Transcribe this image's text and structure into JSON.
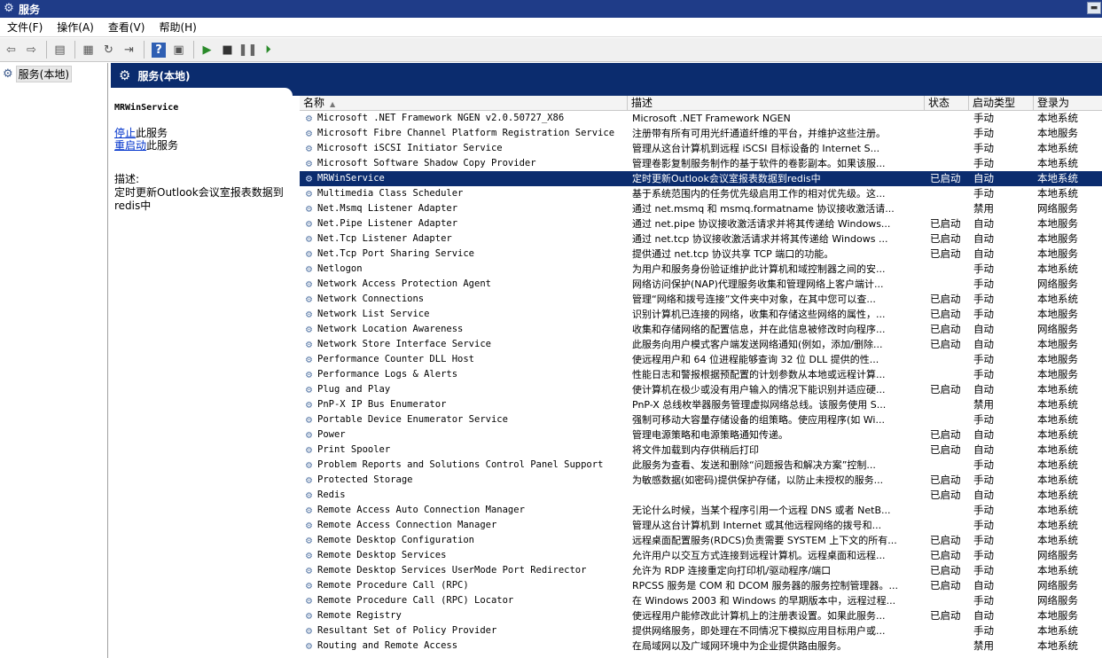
{
  "window": {
    "title": "服务"
  },
  "menu": [
    {
      "label": "文件(F)"
    },
    {
      "label": "操作(A)"
    },
    {
      "label": "查看(V)"
    },
    {
      "label": "帮助(H)"
    }
  ],
  "tree": {
    "item_label": "服务(本地)"
  },
  "main": {
    "title": "服务(本地)"
  },
  "detail": {
    "service_name": "MRWinService",
    "stop_link": "停止",
    "stop_suffix": "此服务",
    "restart_link": "重启动",
    "restart_suffix": "此服务",
    "desc_label": "描述:",
    "description": "定时更新Outlook会议室报表数据到redis中"
  },
  "table": {
    "columns": {
      "name": "名称",
      "desc": "描述",
      "status": "状态",
      "startup": "启动类型",
      "logon": "登录为"
    },
    "selected_index": 4,
    "rows": [
      {
        "name": "Microsoft .NET Framework NGEN v2.0.50727_X86",
        "desc": "Microsoft .NET Framework NGEN",
        "status": "",
        "startup": "手动",
        "logon": "本地系统"
      },
      {
        "name": "Microsoft Fibre Channel Platform Registration Service",
        "desc": "注册带有所有可用光纤通道纤维的平台，并维护这些注册。",
        "status": "",
        "startup": "手动",
        "logon": "本地服务"
      },
      {
        "name": "Microsoft iSCSI Initiator Service",
        "desc": "管理从这台计算机到远程 iSCSI 目标设备的 Internet S...",
        "status": "",
        "startup": "手动",
        "logon": "本地系统"
      },
      {
        "name": "Microsoft Software Shadow Copy Provider",
        "desc": "管理卷影复制服务制作的基于软件的卷影副本。如果该服...",
        "status": "",
        "startup": "手动",
        "logon": "本地系统"
      },
      {
        "name": "MRWinService",
        "desc": "定时更新Outlook会议室报表数据到redis中",
        "status": "已启动",
        "startup": "自动",
        "logon": "本地系统"
      },
      {
        "name": "Multimedia Class Scheduler",
        "desc": "基于系统范围内的任务优先级启用工作的相对优先级。这...",
        "status": "",
        "startup": "手动",
        "logon": "本地系统"
      },
      {
        "name": "Net.Msmq Listener Adapter",
        "desc": "通过 net.msmq 和 msmq.formatname 协议接收激活请...",
        "status": "",
        "startup": "禁用",
        "logon": "网络服务"
      },
      {
        "name": "Net.Pipe Listener Adapter",
        "desc": "通过 net.pipe 协议接收激活请求并将其传递给 Windows...",
        "status": "已启动",
        "startup": "自动",
        "logon": "本地服务"
      },
      {
        "name": "Net.Tcp Listener Adapter",
        "desc": "通过 net.tcp 协议接收激活请求并将其传递给 Windows ...",
        "status": "已启动",
        "startup": "自动",
        "logon": "本地服务"
      },
      {
        "name": "Net.Tcp Port Sharing Service",
        "desc": "提供通过 net.tcp 协议共享 TCP 端口的功能。",
        "status": "已启动",
        "startup": "自动",
        "logon": "本地服务"
      },
      {
        "name": "Netlogon",
        "desc": "为用户和服务身份验证维护此计算机和域控制器之间的安...",
        "status": "",
        "startup": "手动",
        "logon": "本地系统"
      },
      {
        "name": "Network Access Protection Agent",
        "desc": "网络访问保护(NAP)代理服务收集和管理网络上客户端计...",
        "status": "",
        "startup": "手动",
        "logon": "网络服务"
      },
      {
        "name": "Network Connections",
        "desc": "管理“网络和拨号连接”文件夹中对象，在其中您可以查...",
        "status": "已启动",
        "startup": "手动",
        "logon": "本地系统"
      },
      {
        "name": "Network List Service",
        "desc": "识别计算机已连接的网络，收集和存储这些网络的属性，...",
        "status": "已启动",
        "startup": "手动",
        "logon": "本地服务"
      },
      {
        "name": "Network Location Awareness",
        "desc": "收集和存储网络的配置信息，并在此信息被修改时向程序...",
        "status": "已启动",
        "startup": "自动",
        "logon": "网络服务"
      },
      {
        "name": "Network Store Interface Service",
        "desc": "此服务向用户模式客户端发送网络通知(例如，添加/删除...",
        "status": "已启动",
        "startup": "自动",
        "logon": "本地服务"
      },
      {
        "name": "Performance Counter DLL Host",
        "desc": "使远程用户和 64 位进程能够查询 32 位 DLL 提供的性...",
        "status": "",
        "startup": "手动",
        "logon": "本地服务"
      },
      {
        "name": "Performance Logs & Alerts",
        "desc": "性能日志和警报根据预配置的计划参数从本地或远程计算...",
        "status": "",
        "startup": "手动",
        "logon": "本地服务"
      },
      {
        "name": "Plug and Play",
        "desc": "使计算机在极少或没有用户输入的情况下能识别并适应硬...",
        "status": "已启动",
        "startup": "自动",
        "logon": "本地系统"
      },
      {
        "name": "PnP-X IP Bus Enumerator",
        "desc": "PnP-X 总线枚举器服务管理虚拟网络总线。该服务使用 S...",
        "status": "",
        "startup": "禁用",
        "logon": "本地系统"
      },
      {
        "name": "Portable Device Enumerator Service",
        "desc": "强制可移动大容量存储设备的组策略。使应用程序(如 Wi...",
        "status": "",
        "startup": "手动",
        "logon": "本地系统"
      },
      {
        "name": "Power",
        "desc": "管理电源策略和电源策略通知传递。",
        "status": "已启动",
        "startup": "自动",
        "logon": "本地系统"
      },
      {
        "name": "Print Spooler",
        "desc": "将文件加载到内存供稍后打印",
        "status": "已启动",
        "startup": "自动",
        "logon": "本地系统"
      },
      {
        "name": "Problem Reports and Solutions Control Panel Support",
        "desc": "此服务为查看、发送和删除“问题报告和解决方案”控制...",
        "status": "",
        "startup": "手动",
        "logon": "本地系统"
      },
      {
        "name": "Protected Storage",
        "desc": "为敏感数据(如密码)提供保护存储，以防止未授权的服务...",
        "status": "已启动",
        "startup": "手动",
        "logon": "本地系统"
      },
      {
        "name": "Redis",
        "desc": "",
        "status": "已启动",
        "startup": "自动",
        "logon": "本地系统"
      },
      {
        "name": "Remote Access Auto Connection Manager",
        "desc": "无论什么时候，当某个程序引用一个远程 DNS 或者 NetB...",
        "status": "",
        "startup": "手动",
        "logon": "本地系统"
      },
      {
        "name": "Remote Access Connection Manager",
        "desc": "管理从这台计算机到 Internet 或其他远程网络的拨号和...",
        "status": "",
        "startup": "手动",
        "logon": "本地系统"
      },
      {
        "name": "Remote Desktop Configuration",
        "desc": "远程桌面配置服务(RDCS)负责需要 SYSTEM 上下文的所有...",
        "status": "已启动",
        "startup": "手动",
        "logon": "本地系统"
      },
      {
        "name": "Remote Desktop Services",
        "desc": "允许用户以交互方式连接到远程计算机。远程桌面和远程...",
        "status": "已启动",
        "startup": "手动",
        "logon": "网络服务"
      },
      {
        "name": "Remote Desktop Services UserMode Port Redirector",
        "desc": "允许为 RDP 连接重定向打印机/驱动程序/端口",
        "status": "已启动",
        "startup": "手动",
        "logon": "本地系统"
      },
      {
        "name": "Remote Procedure Call (RPC)",
        "desc": "RPCSS 服务是 COM 和 DCOM 服务器的服务控制管理器。...",
        "status": "已启动",
        "startup": "自动",
        "logon": "网络服务"
      },
      {
        "name": "Remote Procedure Call (RPC) Locator",
        "desc": "在 Windows 2003 和 Windows 的早期版本中，远程过程...",
        "status": "",
        "startup": "手动",
        "logon": "网络服务"
      },
      {
        "name": "Remote Registry",
        "desc": "使远程用户能修改此计算机上的注册表设置。如果此服务...",
        "status": "已启动",
        "startup": "自动",
        "logon": "本地服务"
      },
      {
        "name": "Resultant Set of Policy Provider",
        "desc": "提供网络服务，即处理在不同情况下模拟应用目标用户或...",
        "status": "",
        "startup": "手动",
        "logon": "本地系统"
      },
      {
        "name": "Routing and Remote Access",
        "desc": "在局域网以及广域网环境中为企业提供路由服务。",
        "status": "",
        "startup": "禁用",
        "logon": "本地系统"
      }
    ]
  }
}
